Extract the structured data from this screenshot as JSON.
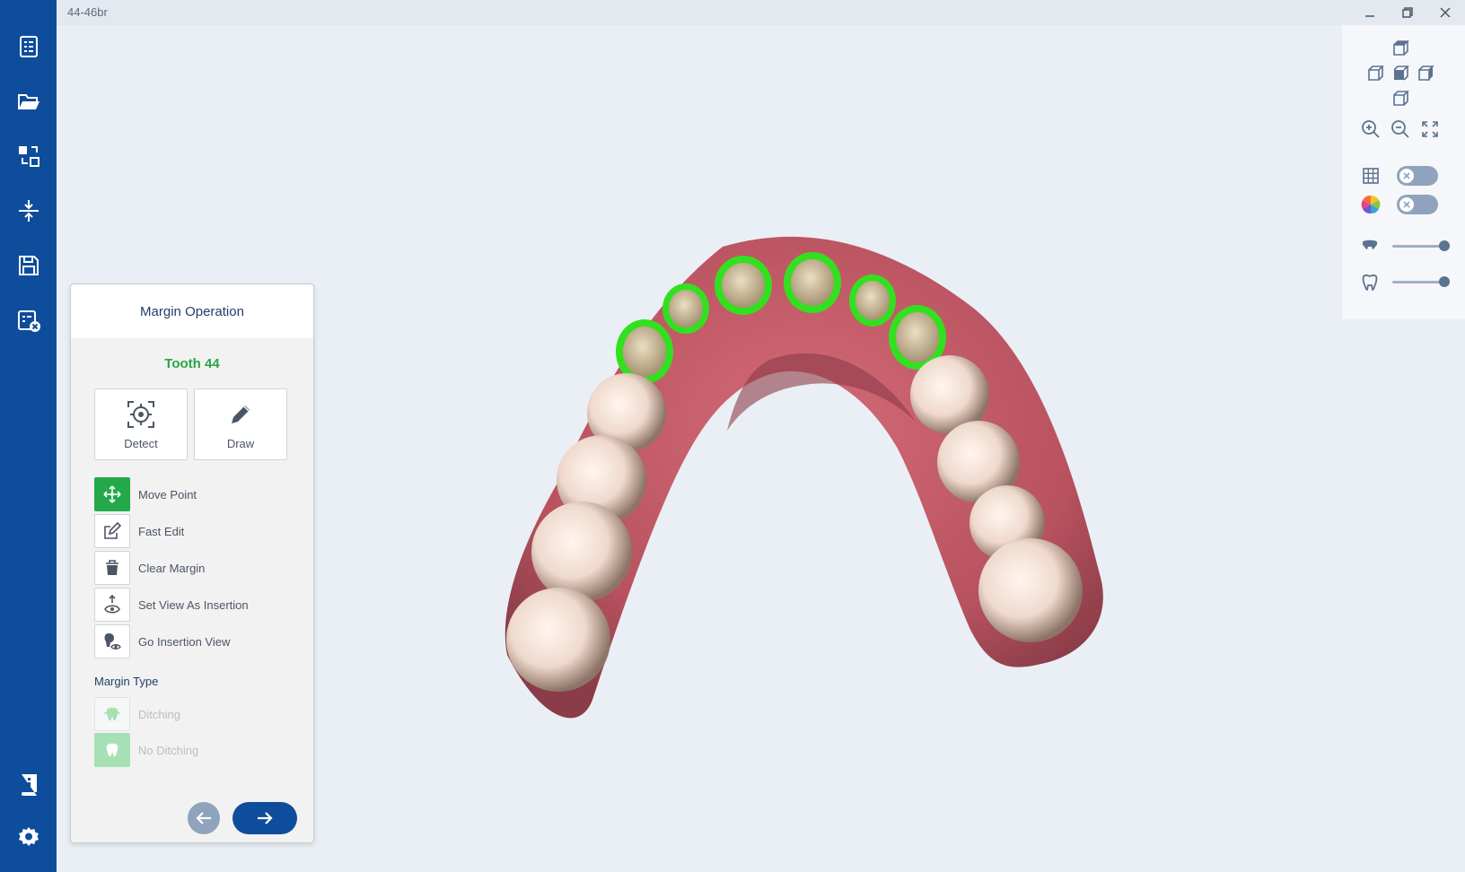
{
  "window": {
    "title": "44-46br"
  },
  "rail": {
    "items": [
      {
        "icon": "order-form-icon"
      },
      {
        "icon": "open-folder-icon"
      },
      {
        "icon": "swap-icon"
      },
      {
        "icon": "align-icon"
      },
      {
        "icon": "save-icon"
      },
      {
        "icon": "close-order-icon"
      },
      {
        "icon": "manual-icon"
      },
      {
        "icon": "settings-icon"
      }
    ]
  },
  "panel": {
    "title": "Margin Operation",
    "tooth_label": "Tooth 44",
    "detect_label": "Detect",
    "draw_label": "Draw",
    "actions": {
      "move_point": "Move Point",
      "fast_edit": "Fast Edit",
      "clear_margin": "Clear Margin",
      "set_view": "Set View As Insertion",
      "go_insertion": "Go Insertion View"
    },
    "margin_type_title": "Margin Type",
    "margin_types": {
      "ditching": "Ditching",
      "no_ditching": "No Ditching"
    }
  },
  "tools": {
    "grid_toggle": false,
    "color_toggle": false,
    "upper_jaw_opacity": 1.0,
    "lower_jaw_opacity": 1.0
  },
  "colors": {
    "rail": "#0e4d9c",
    "accent_green": "#23a94a",
    "margin_line": "#33e01f",
    "gum": "#c8606c"
  }
}
